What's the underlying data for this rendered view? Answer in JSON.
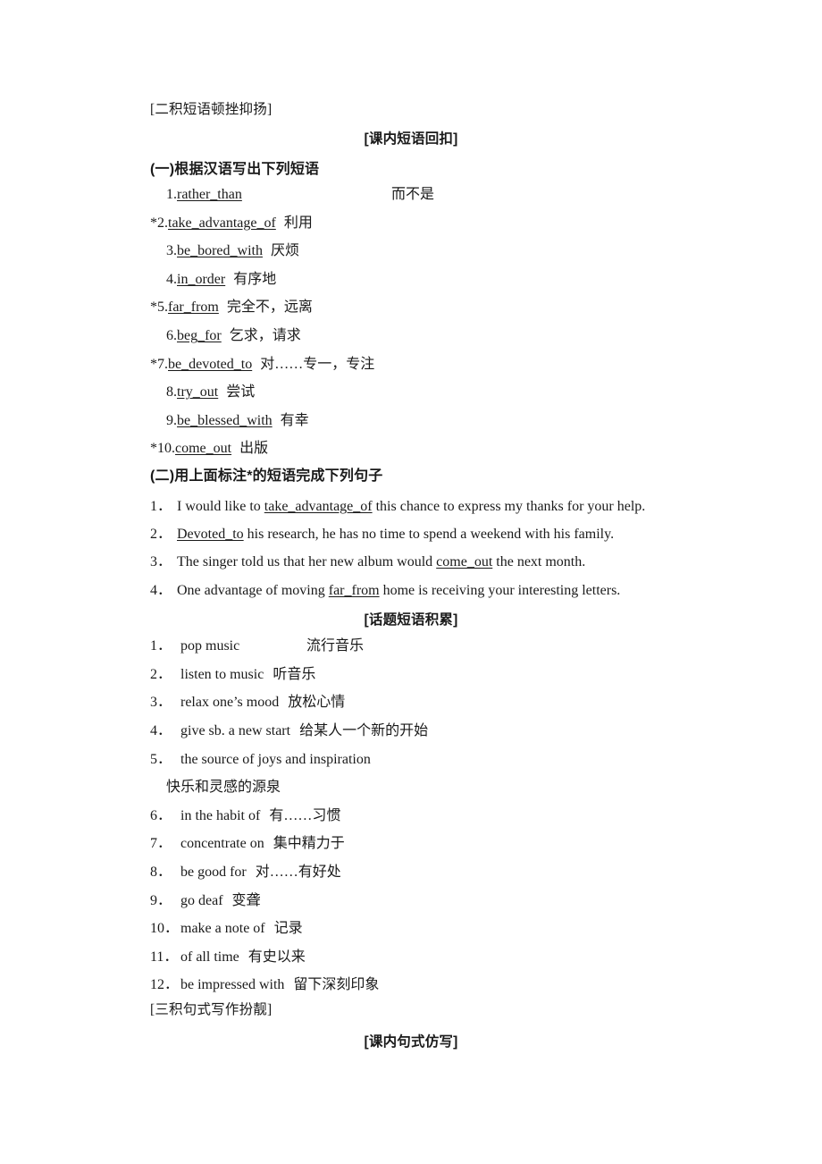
{
  "page": {
    "section_a_heading": "[二积短语顿挫抑扬]",
    "section_a_sub_heading": "[课内短语回扣]",
    "part_one_heading": "(一)根据汉语写出下列短语",
    "part_two_heading": "(二)用上面标注*的短语完成下列句子",
    "topic_heading": "[话题短语积累]",
    "section_b_heading": "[三积句式写作扮靓]",
    "section_b_sub_heading": "[课内句式仿写]"
  },
  "phrases": [
    {
      "star": "",
      "num": "1.",
      "en": "rather_than",
      "cn": "而不是",
      "cn_far": true
    },
    {
      "star": "*",
      "num": "2.",
      "en": "take_advantage_of",
      "cn": "利用",
      "cn_far": false
    },
    {
      "star": "",
      "num": "3.",
      "en": "be_bored_with",
      "cn": "厌烦",
      "cn_far": false
    },
    {
      "star": "",
      "num": "4.",
      "en": "in_order",
      "cn": "有序地",
      "cn_far": false
    },
    {
      "star": "*",
      "num": "5.",
      "en": "far_from",
      "cn": "完全不，远离",
      "cn_far": false
    },
    {
      "star": "",
      "num": "6.",
      "en": "beg_for",
      "cn": "乞求，请求",
      "cn_far": false
    },
    {
      "star": "*",
      "num": "7.",
      "en": "be_devoted_to",
      "cn": "对……专一，专注",
      "cn_far": false
    },
    {
      "star": "",
      "num": "8.",
      "en": "try_out",
      "cn": "尝试",
      "cn_far": false
    },
    {
      "star": "",
      "num": "9.",
      "en": "be_blessed_with",
      "cn": "有幸",
      "cn_far": false
    },
    {
      "star": "*",
      "num": "10.",
      "en": "come_out",
      "cn": "出版",
      "cn_far": false
    }
  ],
  "sentences": [
    {
      "num": "1．",
      "pre": "I would like to ",
      "blank": "take_advantage_of",
      "post": " this chance to express my thanks for your help."
    },
    {
      "num": "2．",
      "pre": "",
      "blank": "Devoted_to",
      "post": " his research, he has no time to spend a weekend with his family."
    },
    {
      "num": "3．",
      "pre": "The singer told us that her new album would ",
      "blank": "come_out",
      "post": " the next month."
    },
    {
      "num": "4．",
      "pre": "One advantage of moving ",
      "blank": "far_from",
      "post": " home is receiving your interesting letters."
    }
  ],
  "topics": [
    {
      "num": "1．",
      "en": "pop music",
      "cn": "流行音乐",
      "cn_far": true,
      "cont": ""
    },
    {
      "num": "2．",
      "en": "listen to music",
      "cn": "听音乐",
      "cn_far": false,
      "cont": ""
    },
    {
      "num": "3．",
      "en": "relax one’s mood",
      "cn": "放松心情",
      "cn_far": false,
      "cont": ""
    },
    {
      "num": "4．",
      "en": "give sb. a new start",
      "cn": "给某人一个新的开始",
      "cn_far": false,
      "cont": ""
    },
    {
      "num": "5．",
      "en": "the source of joys and inspiration",
      "cn": "",
      "cn_far": false,
      "cont": "快乐和灵感的源泉"
    },
    {
      "num": "6．",
      "en": "in the habit of",
      "cn": "有……习惯",
      "cn_far": false,
      "cont": ""
    },
    {
      "num": "7．",
      "en": "concentrate on",
      "cn": "集中精力于",
      "cn_far": false,
      "cont": ""
    },
    {
      "num": "8．",
      "en": "be good for",
      "cn": "对……有好处",
      "cn_far": false,
      "cont": ""
    },
    {
      "num": "9．",
      "en": "go deaf",
      "cn": "变聋",
      "cn_far": false,
      "cont": ""
    },
    {
      "num": "10．",
      "en": "make a note of",
      "cn": "记录",
      "cn_far": false,
      "cont": ""
    },
    {
      "num": "11．",
      "en": "of all time",
      "cn": "有史以来",
      "cn_far": false,
      "cont": ""
    },
    {
      "num": "12．",
      "en": "be impressed with",
      "cn": "留下深刻印象",
      "cn_far": false,
      "cont": ""
    }
  ]
}
